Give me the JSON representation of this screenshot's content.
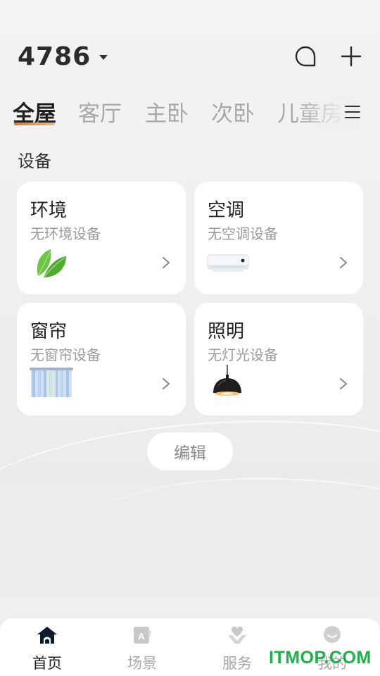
{
  "header": {
    "home_name": "4786",
    "message_icon": "chat-bubble-icon",
    "add_icon": "plus-icon"
  },
  "tabs": [
    {
      "label": "全屋",
      "active": true
    },
    {
      "label": "客厅",
      "active": false
    },
    {
      "label": "主卧",
      "active": false
    },
    {
      "label": "次卧",
      "active": false
    },
    {
      "label": "儿童房",
      "active": false
    }
  ],
  "tabs_menu_icon": "hamburger-menu-icon",
  "section_title": "设备",
  "cards": [
    {
      "title": "环境",
      "subtitle": "无环境设备",
      "icon": "leaf-icon"
    },
    {
      "title": "空调",
      "subtitle": "无空调设备",
      "icon": "air-conditioner-icon"
    },
    {
      "title": "窗帘",
      "subtitle": "无窗帘设备",
      "icon": "curtain-icon"
    },
    {
      "title": "照明",
      "subtitle": "无灯光设备",
      "icon": "pendant-lamp-icon"
    }
  ],
  "edit_label": "编辑",
  "bottom_nav": [
    {
      "label": "首页",
      "icon": "home-icon",
      "active": true
    },
    {
      "label": "场景",
      "icon": "scene-icon",
      "active": false
    },
    {
      "label": "服务",
      "icon": "service-icon",
      "active": false
    },
    {
      "label": "我的",
      "icon": "profile-icon",
      "active": false
    }
  ],
  "watermark": "ITMOP.COM",
  "colors": {
    "accent_underline": "#c2814a",
    "active_text": "#1f1f1f",
    "inactive_text": "#a8a8a8",
    "watermark": "#19b34a"
  }
}
